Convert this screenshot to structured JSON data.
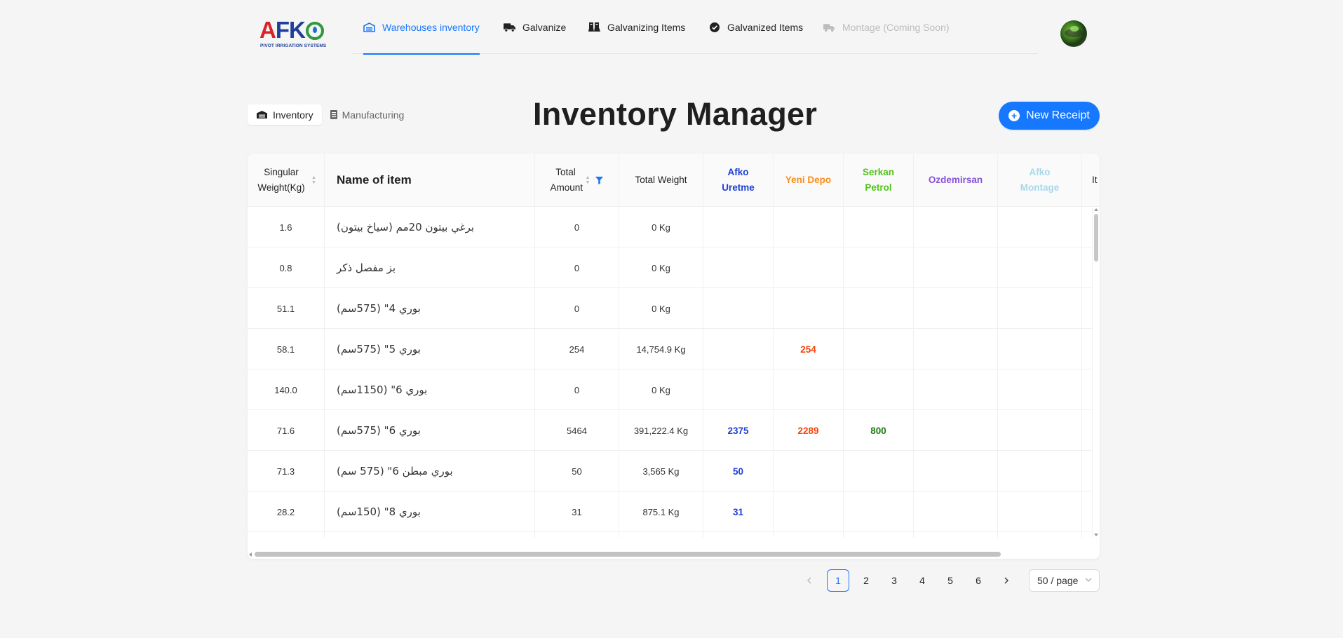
{
  "logo": {
    "brand_a": "A",
    "brand_fk": "FK",
    "subtitle": "PIVOT IRRIGATION SYSTEMS"
  },
  "nav": {
    "items": [
      {
        "label": "Warehouses inventory",
        "icon": "warehouse-icon",
        "state": "active"
      },
      {
        "label": "Galvanize",
        "icon": "truck-icon",
        "state": "normal"
      },
      {
        "label": "Galvanizing Items",
        "icon": "flask-icon",
        "state": "normal"
      },
      {
        "label": "Galvanized Items",
        "icon": "check-circle-icon",
        "state": "normal"
      },
      {
        "label": "Montage (Coming Soon)",
        "icon": "trucks-icon",
        "state": "disabled"
      }
    ]
  },
  "segmented": {
    "inventory": "Inventory",
    "manufacturing": "Manufacturing"
  },
  "page": {
    "title": "Inventory Manager",
    "new_receipt": "New Receipt"
  },
  "table": {
    "columns": {
      "weight": "Singular Weight(Kg)",
      "name": "Name of item",
      "amount": "Total Amount",
      "total_weight": "Total Weight",
      "afko_uretme": "Afko Uretme",
      "yeni_depo": "Yeni Depo",
      "serkan_petrol": "Serkan Petrol",
      "ozdemirsan": "Ozdemirsan",
      "afko_montage": "Afko Montage",
      "cut_off": "It"
    },
    "colors": {
      "afko_uretme": "#1e40d6",
      "yeni_depo": "#fa8c16",
      "yeni_depo_values": "#f5440c",
      "serkan_petrol": "#52c41a",
      "serkan_petrol_values": "#1c7a12",
      "ozdemirsan": "#8652d9",
      "afko_montage": "#a8d8ea"
    },
    "rows": [
      {
        "weight": "1.6",
        "name": "برغي بيتون 20مم (سياخ بيتون)",
        "amount": "0",
        "total_weight": "0 Kg",
        "afko_uretme": "",
        "yeni_depo": "",
        "serkan_petrol": "",
        "ozdemirsan": "",
        "afko_montage": ""
      },
      {
        "weight": "0.8",
        "name": "بز مفصل ذكر",
        "amount": "0",
        "total_weight": "0 Kg",
        "afko_uretme": "",
        "yeni_depo": "",
        "serkan_petrol": "",
        "ozdemirsan": "",
        "afko_montage": ""
      },
      {
        "weight": "51.1",
        "name": "بوري 4\" (575سم)",
        "amount": "0",
        "total_weight": "0 Kg",
        "afko_uretme": "",
        "yeni_depo": "",
        "serkan_petrol": "",
        "ozdemirsan": "",
        "afko_montage": ""
      },
      {
        "weight": "58.1",
        "name": "بوري 5\" (575سم)",
        "amount": "254",
        "total_weight": "14,754.9 Kg",
        "afko_uretme": "",
        "yeni_depo": "254",
        "serkan_petrol": "",
        "ozdemirsan": "",
        "afko_montage": ""
      },
      {
        "weight": "140.0",
        "name": "بوري 6\" (1150سم)",
        "amount": "0",
        "total_weight": "0 Kg",
        "afko_uretme": "",
        "yeni_depo": "",
        "serkan_petrol": "",
        "ozdemirsan": "",
        "afko_montage": ""
      },
      {
        "weight": "71.6",
        "name": "بوري 6\" (575سم)",
        "amount": "5464",
        "total_weight": "391,222.4 Kg",
        "afko_uretme": "2375",
        "yeni_depo": "2289",
        "serkan_petrol": "800",
        "ozdemirsan": "",
        "afko_montage": ""
      },
      {
        "weight": "71.3",
        "name": "بوري مبطن 6\" (575 سم)",
        "amount": "50",
        "total_weight": "3,565 Kg",
        "afko_uretme": "50",
        "yeni_depo": "",
        "serkan_petrol": "",
        "ozdemirsan": "",
        "afko_montage": ""
      },
      {
        "weight": "28.2",
        "name": "بوري 8\" (150سم)",
        "amount": "31",
        "total_weight": "875.1 Kg",
        "afko_uretme": "31",
        "yeni_depo": "",
        "serkan_petrol": "",
        "ozdemirsan": "",
        "afko_montage": ""
      }
    ]
  },
  "pagination": {
    "pages": [
      "1",
      "2",
      "3",
      "4",
      "5",
      "6"
    ],
    "current": "1",
    "page_size": "50 / page"
  }
}
